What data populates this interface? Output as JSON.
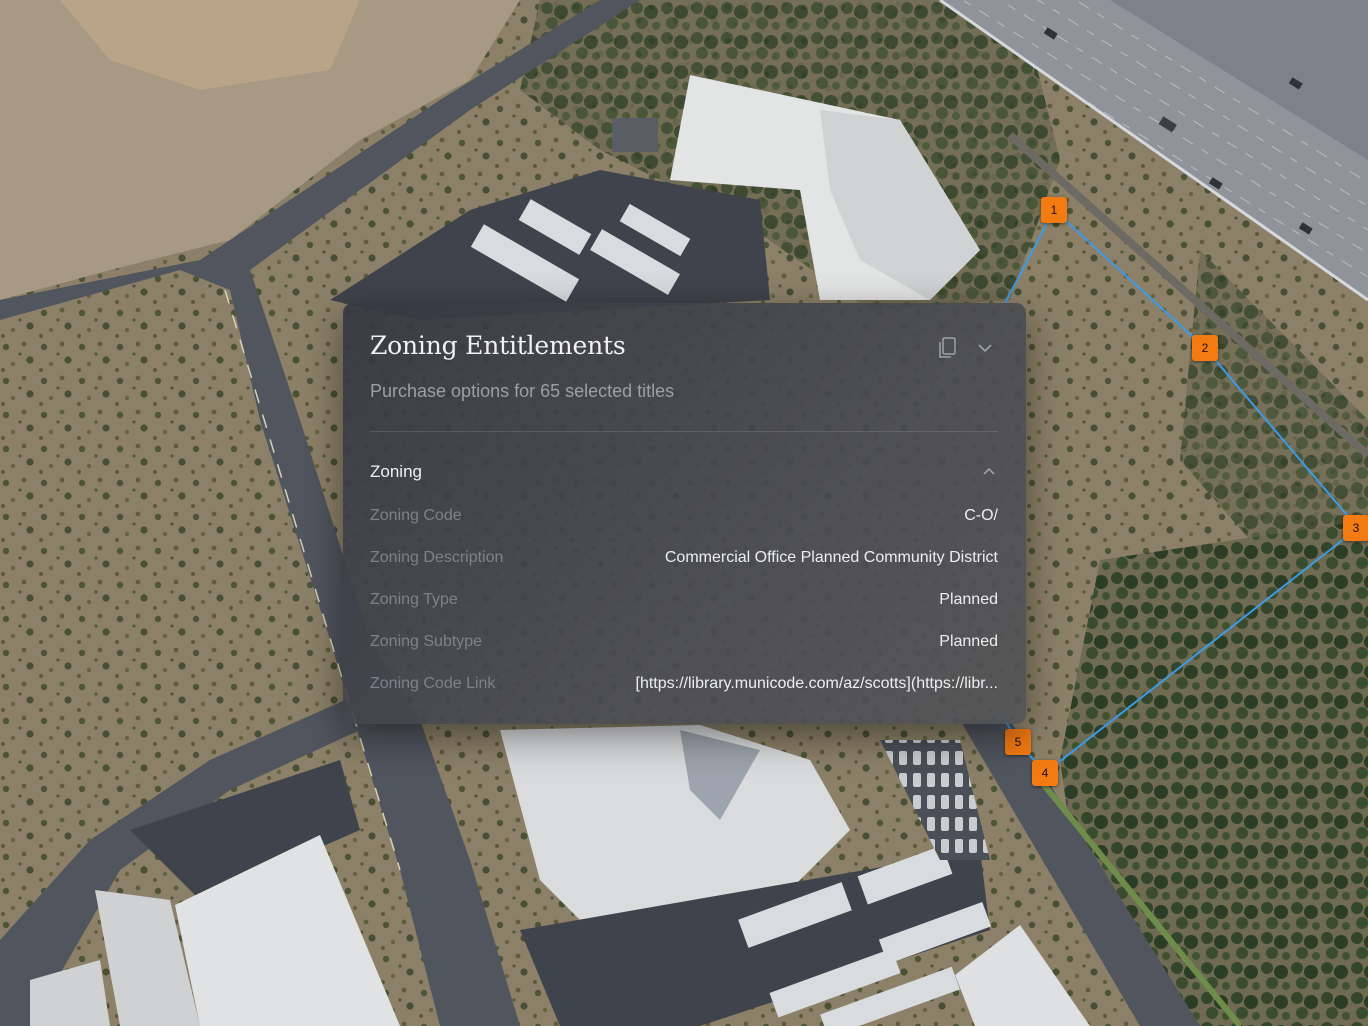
{
  "map": {
    "parcel_markers": [
      {
        "label": "1"
      },
      {
        "label": "2"
      },
      {
        "label": "3"
      },
      {
        "label": "4"
      },
      {
        "label": "5"
      }
    ],
    "accent_color": "#f47a12",
    "boundary_color": "#3b9be8"
  },
  "panel": {
    "title": "Zoning Entitlements",
    "subtitle": "Purchase options for 65 selected titles",
    "copy_icon": "copy-icon",
    "collapse_icon": "chevron-down-icon",
    "section": {
      "title": "Zoning",
      "toggle_icon": "chevron-up-icon",
      "rows": [
        {
          "label": "Zoning Code",
          "value": "C-O/"
        },
        {
          "label": "Zoning Description",
          "value": "Commercial Office Planned Community District"
        },
        {
          "label": "Zoning Type",
          "value": "Planned"
        },
        {
          "label": "Zoning Subtype",
          "value": "Planned"
        },
        {
          "label": "Zoning Code Link",
          "value": "[https://library.municode.com/az/scotts](https://libr..."
        }
      ]
    }
  }
}
